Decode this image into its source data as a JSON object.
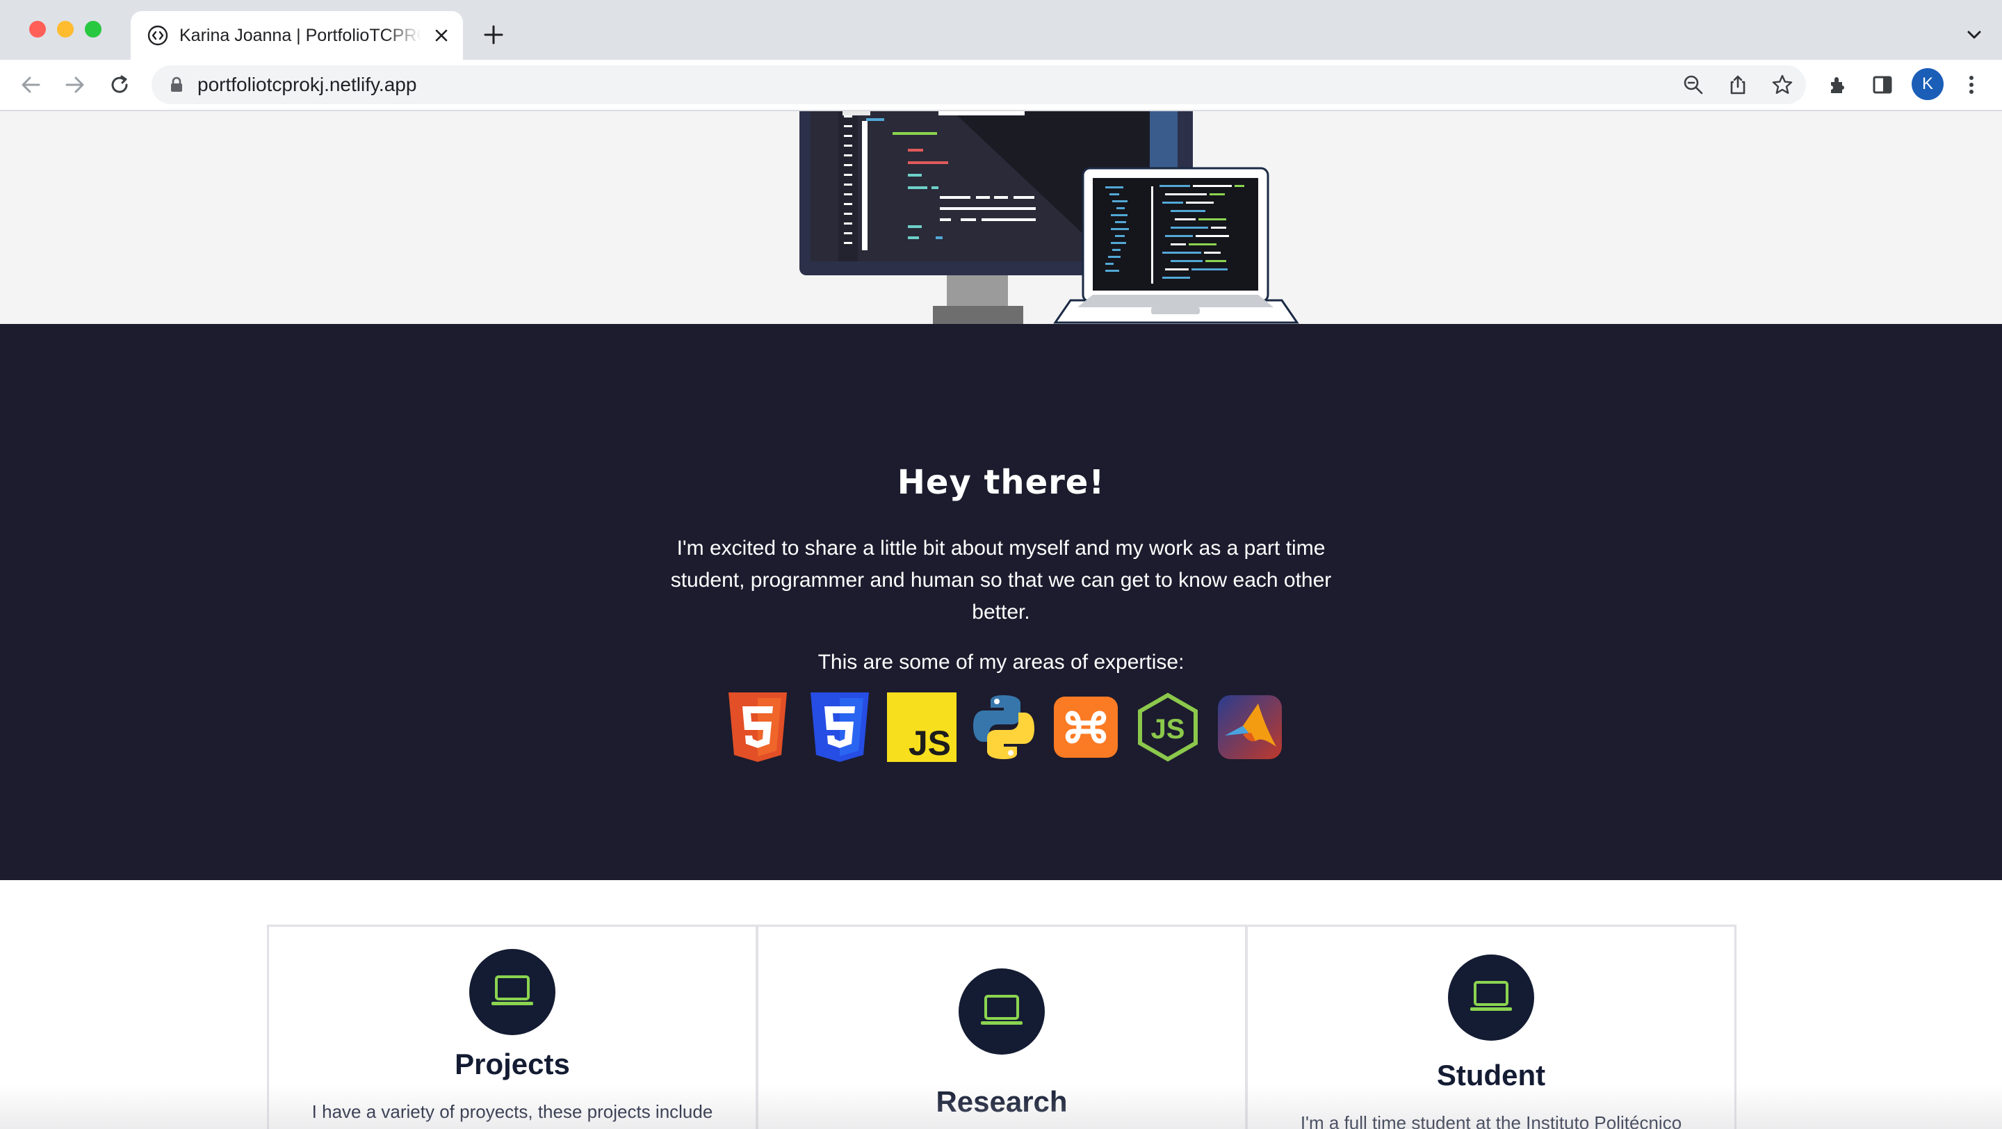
{
  "browser": {
    "tab_title": "Karina Joanna | PortfolioTCPROKJ",
    "url": "portfoliotcprokj.netlify.app",
    "profile_initial": "K",
    "icons": [
      "back-icon",
      "forward-icon",
      "reload-icon",
      "lock-icon",
      "zoom-out-icon",
      "share-icon",
      "bookmark-star-icon",
      "extensions-icon",
      "sidebar-icon",
      "more-icon"
    ]
  },
  "about": {
    "title": "Hey there!",
    "text": "I'm excited to share a little bit about myself and my work as a part time student, programmer and human so that we can get to know each other better.",
    "subtitle": "This are some of my areas of expertise:",
    "skills": [
      "html5-icon",
      "css3-icon",
      "javascript-icon",
      "python-icon",
      "xampp-icon",
      "nodejs-icon",
      "matlab-icon"
    ]
  },
  "services": [
    {
      "title": "Projects",
      "text": "I have a variety of proyects, these projects include",
      "icon": "laptop-icon"
    },
    {
      "title": "Research",
      "text": "",
      "icon": "laptop-icon"
    },
    {
      "title": "Student",
      "text": "I'm a full time student at the Instituto Politécnico",
      "icon": "laptop-icon"
    }
  ],
  "colors": {
    "dark_navy": "#1c1c2e",
    "icon_circle": "#141c33",
    "accent_green": "#8bd450",
    "hero_bg": "#f4f4f5"
  }
}
